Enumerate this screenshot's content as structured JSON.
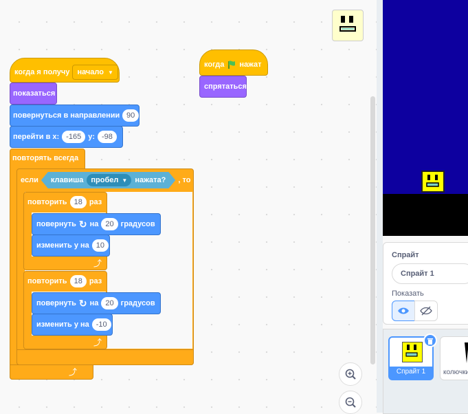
{
  "workspace": {
    "script1": {
      "hat_text": "когда я получу",
      "hat_dropdown": "начало",
      "show": "показаться",
      "point_dir": "повернуться в направлении",
      "point_dir_val": "90",
      "goto_prefix": "перейти в x:",
      "goto_x": "-165",
      "goto_y_label": "y:",
      "goto_y": "-98",
      "forever": "повторять всегда",
      "if_label": "если",
      "if_then": ", то",
      "key_label": "клавиша",
      "key_value": "пробел",
      "key_pressed": "нажата?",
      "repeat1_label": "повторить",
      "repeat1_val": "18",
      "repeat1_suffix": "раз",
      "turn1_label": "повернуть",
      "turn1_on": "на",
      "turn1_val": "20",
      "turn1_suffix": "градусов",
      "changey1_label": "изменить у на",
      "changey1_val": "10",
      "repeat2_label": "повторить",
      "repeat2_val": "18",
      "repeat2_suffix": "раз",
      "turn2_label": "повернуть",
      "turn2_on": "на",
      "turn2_val": "20",
      "turn2_suffix": "градусов",
      "changey2_label": "изменить у на",
      "changey2_val": "-10"
    },
    "script2": {
      "hat_prefix": "когда",
      "hat_suffix": "нажат",
      "hide": "спрятаться"
    },
    "zoom_in_icon": "zoom-in-icon",
    "zoom_out_icon": "zoom-out-icon"
  },
  "sprite_panel": {
    "sprite_label": "Спрайт",
    "sprite_name": "Спрайт 1",
    "show_label": "Показать"
  },
  "sprite_list": {
    "items": [
      {
        "name": "Спрайт 1"
      },
      {
        "name": "колючки"
      }
    ]
  },
  "colors": {
    "events": "#ffbf00",
    "looks": "#9966ff",
    "motion": "#4c97ff",
    "control": "#ffab19",
    "sensing": "#5cb1d6",
    "stage_bg": "#0d009f",
    "ground": "#000000",
    "selected": "#4c97ff"
  }
}
